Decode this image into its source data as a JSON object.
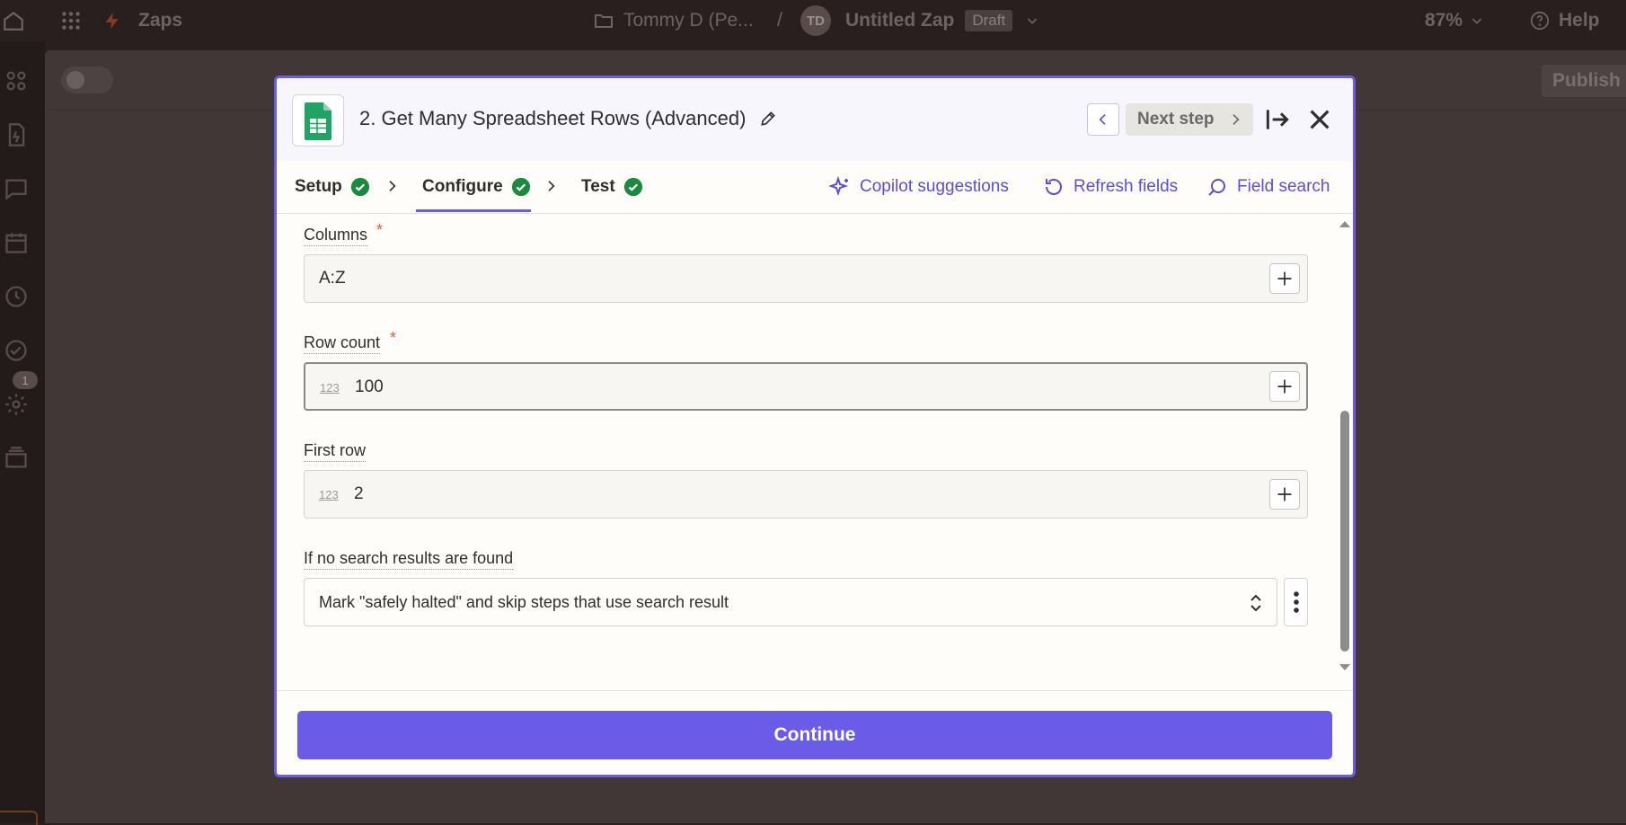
{
  "topbar": {
    "app_name": "Zaps",
    "folder": "Tommy D (Pe...",
    "separator": "/",
    "avatar_initials": "TD",
    "zap_name": "Untitled Zap",
    "status": "Draft",
    "zoom": "87%",
    "help": "Help"
  },
  "sidebar": {
    "notification_count": "1"
  },
  "canvas": {
    "publish_label": "Publish"
  },
  "modal": {
    "title": "2. Get Many Spreadsheet Rows (Advanced)",
    "next_step_label": "Next step",
    "tabs": [
      {
        "label": "Setup",
        "complete": true
      },
      {
        "label": "Configure",
        "complete": true,
        "active": true
      },
      {
        "label": "Test",
        "complete": true
      }
    ],
    "actions": {
      "copilot": "Copilot suggestions",
      "refresh": "Refresh fields",
      "search": "Field search"
    },
    "fields": {
      "columns": {
        "label": "Columns",
        "required": "*",
        "value": "A:Z"
      },
      "row_count": {
        "label": "Row count",
        "required": "*",
        "type_hint": "123",
        "value": "100"
      },
      "first_row": {
        "label": "First row",
        "type_hint": "123",
        "value": "2"
      },
      "no_results": {
        "label": "If no search results are found",
        "value": "Mark \"safely halted\" and skip steps that use search result"
      }
    },
    "continue_label": "Continue"
  },
  "colors": {
    "accent": "#6b5ce7",
    "success": "#1a8a3f",
    "required": "#f0592d",
    "sheets_green": "#1fa463"
  }
}
